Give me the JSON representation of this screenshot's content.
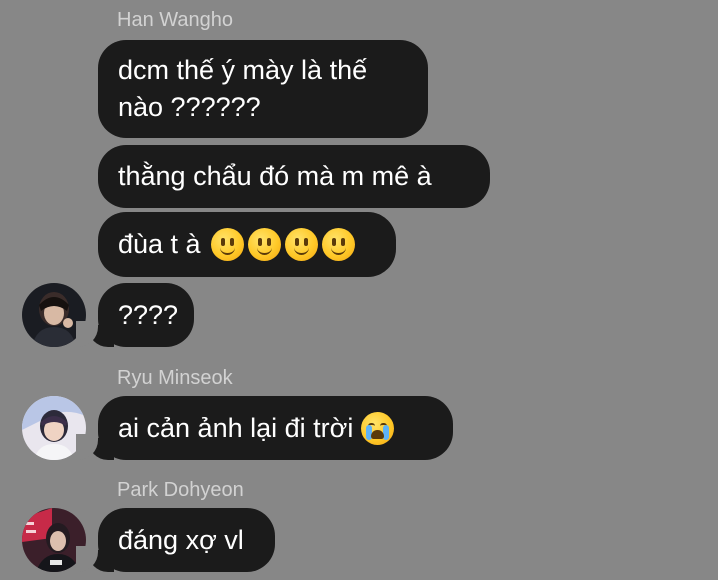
{
  "messages": [
    {
      "sender": "Han Wangho",
      "lines": [
        "dcm thế ý mày là thế\nnào ??????",
        "thằng chẩu đó mà m mê à",
        "đùa t à"
      ],
      "emoji_icons": [
        "slightly-smiling-face",
        "slightly-smiling-face",
        "slightly-smiling-face",
        "slightly-smiling-face"
      ],
      "last": "????"
    },
    {
      "sender": "Ryu Minseok",
      "text": "ai cản ảnh lại đi trời",
      "emoji_icon": "loudly-crying-face"
    },
    {
      "sender": "Park Dohyeon",
      "text": "đáng xợ vl"
    }
  ],
  "colors": {
    "background": "#878787",
    "bubble": "#1b1b1b",
    "bubble_text": "#ffffff",
    "sender_text": "#d2d2d2"
  }
}
